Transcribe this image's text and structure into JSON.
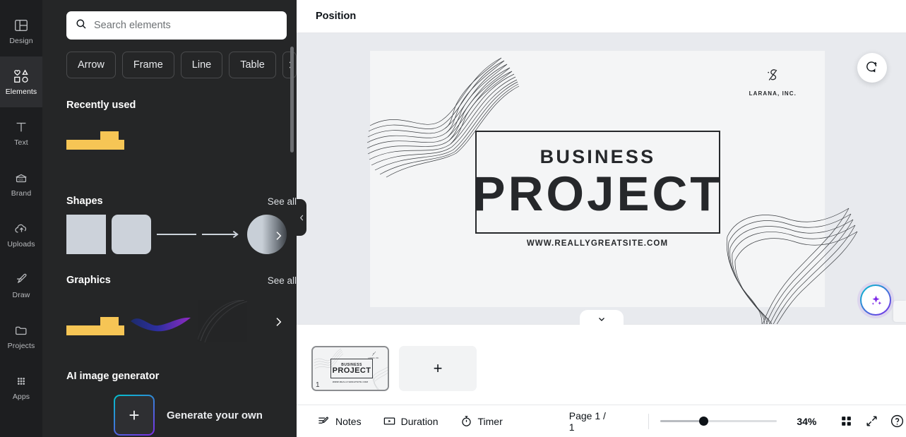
{
  "rail": {
    "items": [
      {
        "label": "Design",
        "icon": "design-icon",
        "active": false
      },
      {
        "label": "Elements",
        "icon": "elements-icon",
        "active": true
      },
      {
        "label": "Text",
        "icon": "text-icon",
        "active": false
      },
      {
        "label": "Brand",
        "icon": "brand-icon",
        "active": false
      },
      {
        "label": "Uploads",
        "icon": "uploads-icon",
        "active": false
      },
      {
        "label": "Draw",
        "icon": "draw-icon",
        "active": false
      },
      {
        "label": "Projects",
        "icon": "projects-icon",
        "active": false
      },
      {
        "label": "Apps",
        "icon": "apps-icon",
        "active": false
      }
    ]
  },
  "panel": {
    "search": {
      "placeholder": "Search elements",
      "value": "",
      "icon": "search-icon"
    },
    "chips": [
      "Arrow",
      "Frame",
      "Line",
      "Table"
    ],
    "chip_more_icon": "chevron-right-icon",
    "sections": [
      {
        "title": "Recently used",
        "see_all": ""
      },
      {
        "title": "Shapes",
        "see_all": "See all"
      },
      {
        "title": "Graphics",
        "see_all": "See all"
      },
      {
        "title": "AI image generator",
        "see_all": ""
      }
    ],
    "ai": {
      "plus": "+",
      "label": "Generate your own"
    },
    "collapse_icon": "chevron-left-icon"
  },
  "topbar": {
    "title": "Position"
  },
  "canvas": {
    "slide": {
      "eyebrow": "BUSINESS",
      "headline": "PROJECT",
      "website": "WWW.REALLYGREATSITE.COM",
      "logo_name": "LARANA, INC."
    },
    "comment_button_icon": "add-comment-icon",
    "ai_button_icon": "magic-sparkles-icon",
    "strip_handle_icon": "chevron-down-icon"
  },
  "pages": {
    "thumbnail": {
      "number": "1",
      "eyebrow": "BUSINESS",
      "headline": "PROJECT",
      "website": "WWW.REALLYGREATSITE.COM"
    },
    "add_page_label": "+"
  },
  "bottombar": {
    "notes": {
      "label": "Notes",
      "icon": "notes-icon"
    },
    "duration": {
      "label": "Duration",
      "icon": "duration-icon"
    },
    "timer": {
      "label": "Timer",
      "icon": "timer-icon"
    },
    "page_indicator": "Page 1 / 1",
    "zoom_level": "34%",
    "grid_view_icon": "grid-view-icon",
    "fullscreen_icon": "fullscreen-icon",
    "help_icon": "help-icon"
  },
  "colors": {
    "rail_bg": "#1d1e20",
    "panel_bg": "#252627",
    "canvas_bg": "#e8eaee",
    "slide_bg": "#f4f5f6",
    "accent_yellow": "#f6c555",
    "ai_gradient_start": "#00c4cc",
    "ai_gradient_end": "#7d2ae8",
    "text_dark": "#0e1318"
  }
}
